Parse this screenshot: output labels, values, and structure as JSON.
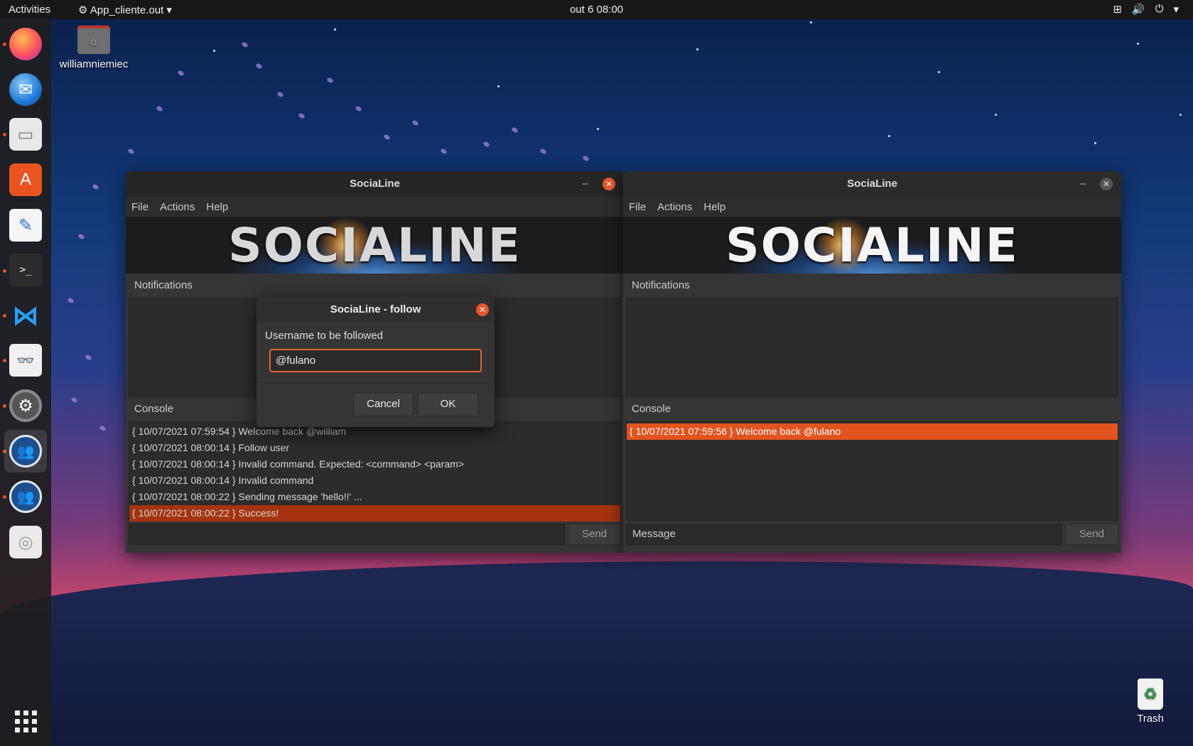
{
  "topbar": {
    "activities": "Activities",
    "app_menu": "App_cliente.out",
    "clock": "out 6  08:00"
  },
  "desktop": {
    "home_label": "williamniemiec",
    "trash_label": "Trash"
  },
  "dock": {
    "items": [
      "firefox-icon",
      "thunderbird-icon",
      "files-icon",
      "ubuntu-software-icon",
      "text-editor-icon",
      "terminal-icon",
      "vscode-icon",
      "document-viewer-icon",
      "settings-icon",
      "socialine-icon",
      "socialine-icon",
      "dvd-icon",
      "show-applications-icon"
    ],
    "terminal_glyph": ">_"
  },
  "left_window": {
    "title": "SociaLine",
    "menu": [
      "File",
      "Actions",
      "Help"
    ],
    "banner": "SOCIALINE",
    "notifications_label": "Notifications",
    "console_label": "Console",
    "console_lines": [
      "{ 10/07/2021 07:59:54 } Welcome back @william",
      "{ 10/07/2021 08:00:14 } Follow user",
      "{ 10/07/2021 08:00:14 } Invalid command. Expected: <command> <param>",
      "{ 10/07/2021 08:00:14 } Invalid command",
      "{ 10/07/2021 08:00:22 } Sending message 'hello!!' ...",
      "{ 10/07/2021 08:00:22 } Success!"
    ],
    "message_value": "",
    "send_label": "Send"
  },
  "right_window": {
    "title": "SociaLine",
    "menu": [
      "File",
      "Actions",
      "Help"
    ],
    "banner": "SOCIALINE",
    "notifications_label": "Notifications",
    "console_label": "Console",
    "console_lines": [
      "{ 10/07/2021 07:59:56 } Welcome back @fulano"
    ],
    "message_placeholder": "Message",
    "send_label": "Send"
  },
  "dialog": {
    "title": "SociaLine - follow",
    "label": "Username to be followed",
    "input_value": "@fulano",
    "cancel_label": "Cancel",
    "ok_label": "OK"
  },
  "colors": {
    "accent": "#e95420",
    "selection": "#e2541f",
    "selection_inactive": "#a4330e",
    "window_bg": "#353535"
  }
}
